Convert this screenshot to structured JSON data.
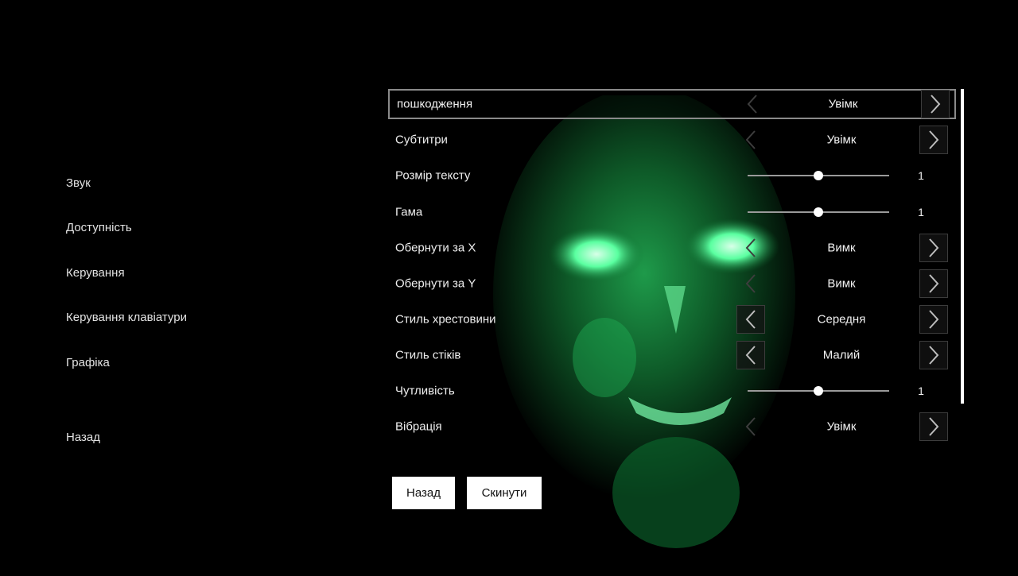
{
  "side_menu": {
    "items": [
      {
        "label": "Звук"
      },
      {
        "label": "Доступність"
      },
      {
        "label": "Керування"
      },
      {
        "label": "Керування клавіатури"
      },
      {
        "label": "Графіка"
      }
    ],
    "back_label": "Назад"
  },
  "settings": [
    {
      "label": "пошкодження",
      "type": "choice",
      "value": "Увімк",
      "left_enabled": false,
      "right_enabled": true,
      "selected": true
    },
    {
      "label": "Субтитри",
      "type": "choice",
      "value": "Увімк",
      "left_enabled": false,
      "right_enabled": true
    },
    {
      "label": "Розмір тексту",
      "type": "slider",
      "value": "1",
      "level": 0.5
    },
    {
      "label": "Гама",
      "type": "slider",
      "value": "1",
      "level": 0.5
    },
    {
      "label": "Обернути за X",
      "type": "choice",
      "value": "Вимк",
      "left_enabled": false,
      "right_enabled": true
    },
    {
      "label": "Обернути за Y",
      "type": "choice",
      "value": "Вимк",
      "left_enabled": false,
      "right_enabled": true
    },
    {
      "label": "Стиль хрестовини",
      "type": "choice",
      "value": "Середня",
      "left_enabled": true,
      "right_enabled": true
    },
    {
      "label": "Стиль стіків",
      "type": "choice",
      "value": "Малий",
      "left_enabled": true,
      "right_enabled": true
    },
    {
      "label": "Чутливість",
      "type": "slider",
      "value": "1",
      "level": 0.5
    },
    {
      "label": "Вібрація",
      "type": "choice",
      "value": "Увімк",
      "left_enabled": false,
      "right_enabled": true
    }
  ],
  "buttons": {
    "back_label": "Назад",
    "reset_label": "Скинути"
  },
  "colors": {
    "background": "#000000",
    "glow": "#2bd36a",
    "button_bg": "#ffffff"
  }
}
